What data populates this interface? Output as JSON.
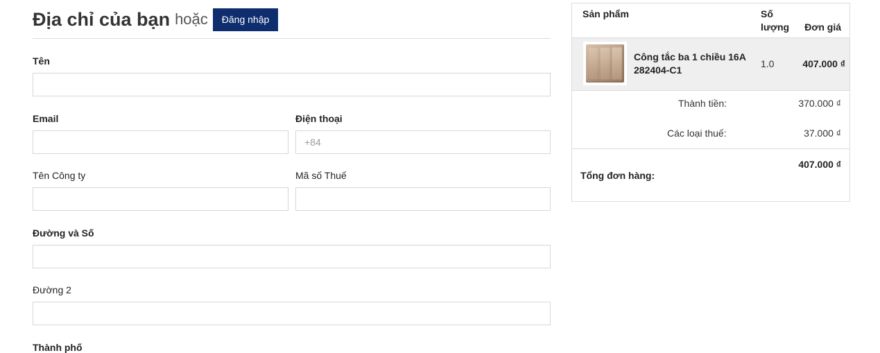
{
  "header": {
    "title": "Địa chỉ của bạn",
    "or_text": "hoặc",
    "login_label": "Đăng nhập"
  },
  "form": {
    "name_label": "Tên",
    "email_label": "Email",
    "phone_label": "Điện thoại",
    "phone_placeholder": "+84",
    "company_label": "Tên Công ty",
    "tax_label": "Mã số Thuế",
    "street_label": "Đường và Số",
    "street2_label": "Đường 2",
    "city_label": "Thành phố"
  },
  "cart": {
    "col_product": "Sản phẩm",
    "col_qty_line1": "Số",
    "col_qty_line2": "lượng",
    "col_price": "Đơn giá",
    "item": {
      "name": "Công tắc ba 1 chiều 16A 282404-C1",
      "qty": "1.0",
      "unit_price": "407.000 ₫"
    },
    "subtotal_label": "Thành tiền:",
    "subtotal_value": "370.000 ₫",
    "tax_label": "Các loại thuế:",
    "tax_value": "37.000 ₫",
    "total_label": "Tổng đơn hàng:",
    "total_value": "407.000 ₫"
  }
}
